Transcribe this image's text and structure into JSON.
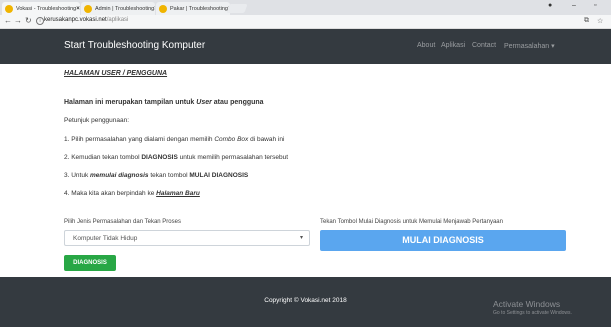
{
  "browser": {
    "tabs": [
      {
        "title": "Vokasi - Troubleshooting",
        "active": true
      },
      {
        "title": "Admin | Troubleshooting",
        "active": false
      },
      {
        "title": "Pakar | Troubleshooting",
        "active": false
      }
    ],
    "url_host": "kerusakanpc.vokasi.net",
    "url_path": "/aplikasi"
  },
  "nav": {
    "brand": "Start Troubleshooting Komputer",
    "links": [
      "About",
      "Aplikasi",
      "Contact",
      "Permasalahan"
    ]
  },
  "main": {
    "heading": "HALAMAN USER / PENGGUNA",
    "intro_prefix": "Halaman ini merupakan tampilan untuk ",
    "intro_em": "User",
    "intro_suffix": " atau pengguna",
    "petunjuk": "Petunjuk penggunaan:",
    "step1_prefix": "1. Pilih permasalahan yang dialami dengan memilih ",
    "step1_em": "Combo Box",
    "step1_suffix": " di bawah ini",
    "step2_prefix": "2. Kemudian tekan tombol ",
    "step2_bold": "DIAGNOSIS",
    "step2_suffix": " untuk memilih permasalahan tersebut",
    "step3_prefix": "3. Untuk ",
    "step3_em": "memulai diagnosis",
    "step3_mid": " tekan tombol ",
    "step3_bold": "MULAI DIAGNOSIS",
    "step4_prefix": "4. Maka kita akan berpindah ke ",
    "step4_link": "Halaman Baru"
  },
  "form": {
    "select_label": "Pilih Jenis Permasalahan dan Tekan Proses",
    "select_value": "Komputer Tidak Hidup",
    "diagnosis_button": "DIAGNOSIS",
    "start_label": "Tekan Tombol Mulai Diagnosis untuk Memulai Menjawab Pertanyaan",
    "start_button": "MULAI DIAGNOSIS"
  },
  "footer": {
    "copyright": "Copyright © Vokasi.net 2018"
  },
  "watermark": {
    "title": "Activate Windows",
    "subtitle": "Go to Settings to activate Windows."
  },
  "colors": {
    "navbar": "#343a40",
    "success": "#28a745",
    "primary": "#5aa6ef"
  },
  "icons": {
    "tab_favicon": "vokasi-favicon-icon",
    "back": "back-arrow-icon",
    "forward": "forward-arrow-icon",
    "reload": "reload-icon",
    "select_chevron": "chevron-down-icon"
  }
}
